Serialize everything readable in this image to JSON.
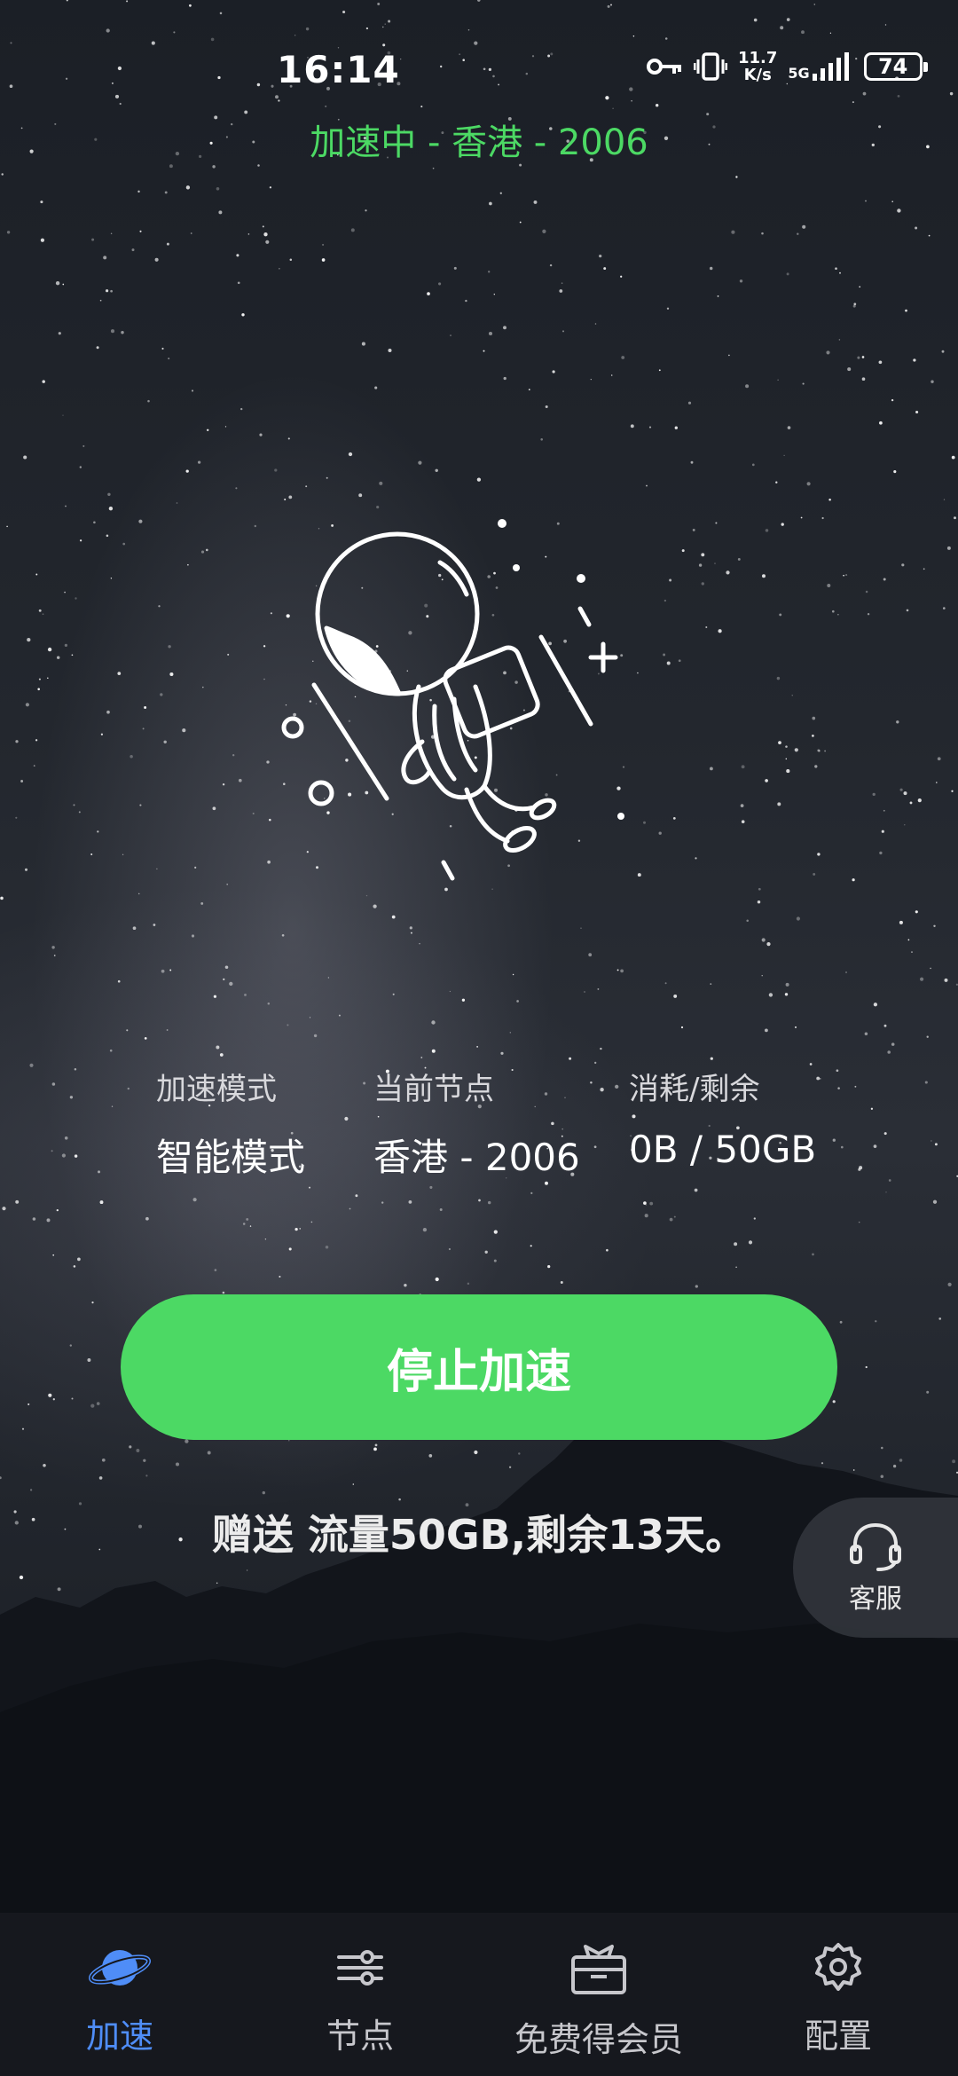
{
  "status_bar": {
    "time": "16:14",
    "speed_value": "11.7",
    "speed_unit": "K/s",
    "network": "5G",
    "battery": "74"
  },
  "connection_status": "加速中 - 香港 - 2006",
  "info": {
    "mode_label": "加速模式",
    "mode_value": "智能模式",
    "node_label": "当前节点",
    "node_value": "香港 - 2006",
    "usage_label": "消耗/剩余",
    "usage_value": "0B / 50GB"
  },
  "stop_button_label": "停止加速",
  "gift_text": "赠送 流量50GB,剩余13天。",
  "customer_service_label": "客服",
  "tabs": [
    {
      "label": "加速",
      "icon": "planet-icon",
      "active": true
    },
    {
      "label": "节点",
      "icon": "nodes-icon",
      "active": false
    },
    {
      "label": "免费得会员",
      "icon": "gift-box-icon",
      "active": false
    },
    {
      "label": "配置",
      "icon": "gear-icon",
      "active": false
    }
  ],
  "colors": {
    "accent_green": "#4cd964",
    "active_tab_blue": "#4f8df7",
    "tabbar_bg": "#16181e"
  }
}
